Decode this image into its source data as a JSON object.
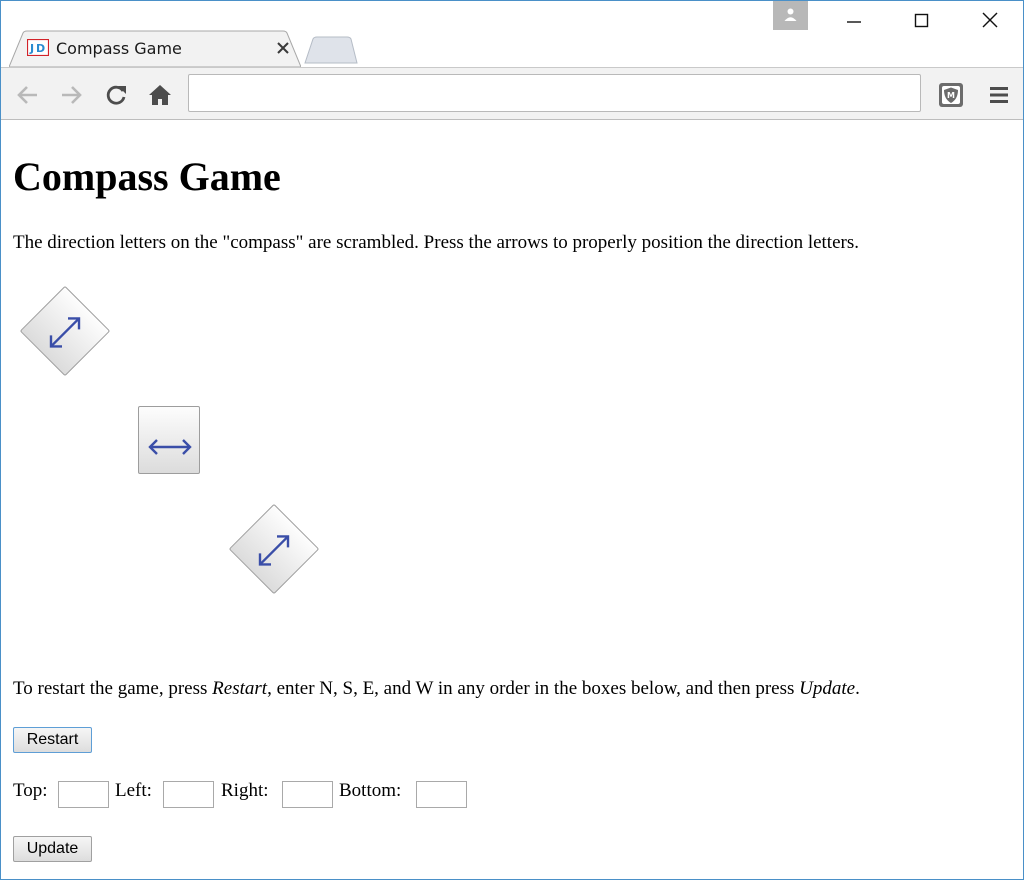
{
  "browser": {
    "tab_title": "Compass Game",
    "address": "",
    "accent": "#4a90c8"
  },
  "page": {
    "heading": "Compass Game",
    "intro": "The direction letters on the \"compass\" are scrambled. Press the arrows to properly position the direction letters.",
    "restart_text_before": "To restart the game, press ",
    "restart_word": "Restart",
    "restart_text_middle": ", enter N, S, E, and W in any order in the boxes below, and then press ",
    "update_word": "Update",
    "restart_text_after": ".",
    "restart_button": "Restart",
    "update_button": "Update",
    "fields": {
      "top_label": "Top:",
      "left_label": "Left:",
      "right_label": "Right:",
      "bottom_label": "Bottom:",
      "top_value": "",
      "left_value": "",
      "right_value": "",
      "bottom_value": ""
    }
  },
  "arrow_buttons": [
    {
      "icon": "double-arrow-diagonal-icon"
    },
    {
      "icon": "double-arrow-horizontal-icon"
    },
    {
      "icon": "double-arrow-diagonal-icon"
    }
  ],
  "colors": {
    "arrow": "#3a4ea8"
  }
}
